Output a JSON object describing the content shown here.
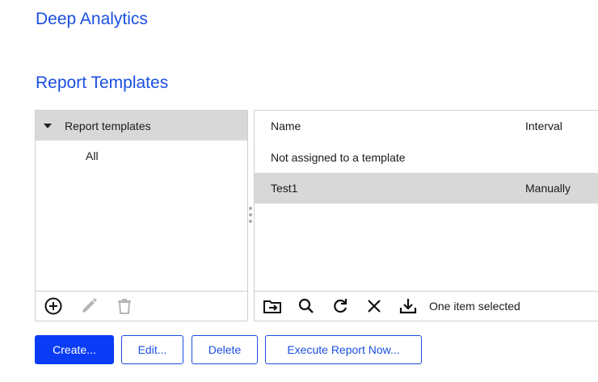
{
  "app": {
    "title": "Deep Analytics"
  },
  "section": {
    "title": "Report Templates"
  },
  "tree": {
    "root_label": "Report templates",
    "children": [
      "All"
    ],
    "toolbar": [
      {
        "icon": "add-circle-icon",
        "enabled": true
      },
      {
        "icon": "pencil-icon",
        "enabled": false
      },
      {
        "icon": "trash-icon",
        "enabled": false
      }
    ]
  },
  "list": {
    "columns": {
      "name": "Name",
      "interval": "Interval"
    },
    "rows": [
      {
        "name": "Not assigned to a template",
        "interval": "",
        "selected": false
      },
      {
        "name": "Test1",
        "interval": "Manually",
        "selected": true
      }
    ],
    "toolbar": [
      "move-to-folder-icon",
      "search-icon",
      "refresh-icon",
      "close-icon",
      "download-icon"
    ],
    "status": "One item selected"
  },
  "buttons": {
    "create": "Create...",
    "edit": "Edit...",
    "delete": "Delete",
    "execute": "Execute Report Now..."
  },
  "colors": {
    "accent": "#1a4fe0",
    "primary_button": "#0a3cf5",
    "selection": "#d8d8d8"
  }
}
